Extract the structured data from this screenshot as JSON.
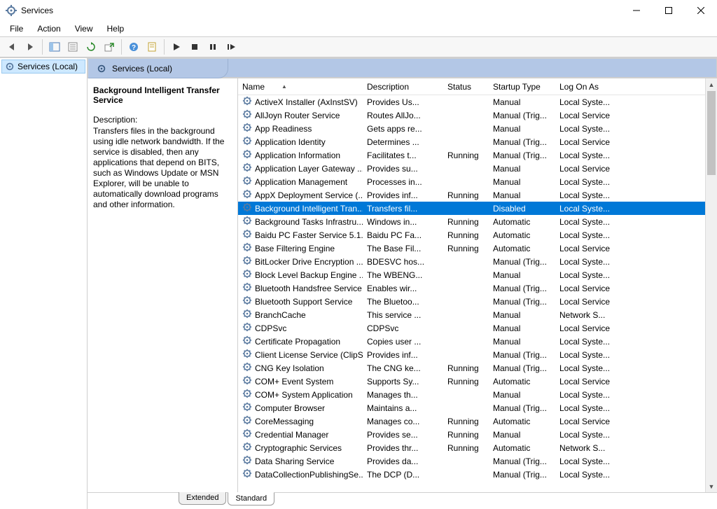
{
  "window": {
    "title": "Services"
  },
  "menu": {
    "file": "File",
    "action": "Action",
    "view": "View",
    "help": "Help"
  },
  "tree": {
    "root": "Services (Local)"
  },
  "header": {
    "label": "Services (Local)"
  },
  "detail": {
    "title": "Background Intelligent Transfer Service",
    "desc_label": "Description:",
    "desc": "Transfers files in the background using idle network bandwidth. If the service is disabled, then any applications that depend on BITS, such as Windows Update or MSN Explorer, will be unable to automatically download programs and other information."
  },
  "columns": {
    "name": "Name",
    "desc": "Description",
    "status": "Status",
    "startup": "Startup Type",
    "logon": "Log On As"
  },
  "tabs": {
    "extended": "Extended",
    "standard": "Standard"
  },
  "services": [
    {
      "name": "ActiveX Installer (AxInstSV)",
      "desc": "Provides Us...",
      "status": "",
      "startup": "Manual",
      "logon": "Local Syste..."
    },
    {
      "name": "AllJoyn Router Service",
      "desc": "Routes AllJo...",
      "status": "",
      "startup": "Manual (Trig...",
      "logon": "Local Service"
    },
    {
      "name": "App Readiness",
      "desc": "Gets apps re...",
      "status": "",
      "startup": "Manual",
      "logon": "Local Syste..."
    },
    {
      "name": "Application Identity",
      "desc": "Determines ...",
      "status": "",
      "startup": "Manual (Trig...",
      "logon": "Local Service"
    },
    {
      "name": "Application Information",
      "desc": "Facilitates t...",
      "status": "Running",
      "startup": "Manual (Trig...",
      "logon": "Local Syste..."
    },
    {
      "name": "Application Layer Gateway ...",
      "desc": "Provides su...",
      "status": "",
      "startup": "Manual",
      "logon": "Local Service"
    },
    {
      "name": "Application Management",
      "desc": "Processes in...",
      "status": "",
      "startup": "Manual",
      "logon": "Local Syste..."
    },
    {
      "name": "AppX Deployment Service (...",
      "desc": "Provides inf...",
      "status": "Running",
      "startup": "Manual",
      "logon": "Local Syste..."
    },
    {
      "name": "Background Intelligent Tran...",
      "desc": "Transfers fil...",
      "status": "",
      "startup": "Disabled",
      "logon": "Local Syste...",
      "selected": true
    },
    {
      "name": "Background Tasks Infrastru...",
      "desc": "Windows in...",
      "status": "Running",
      "startup": "Automatic",
      "logon": "Local Syste..."
    },
    {
      "name": "Baidu PC Faster Service 5.1....",
      "desc": "Baidu PC Fa...",
      "status": "Running",
      "startup": "Automatic",
      "logon": "Local Syste..."
    },
    {
      "name": "Base Filtering Engine",
      "desc": "The Base Fil...",
      "status": "Running",
      "startup": "Automatic",
      "logon": "Local Service"
    },
    {
      "name": "BitLocker Drive Encryption ...",
      "desc": "BDESVC hos...",
      "status": "",
      "startup": "Manual (Trig...",
      "logon": "Local Syste..."
    },
    {
      "name": "Block Level Backup Engine ...",
      "desc": "The WBENG...",
      "status": "",
      "startup": "Manual",
      "logon": "Local Syste..."
    },
    {
      "name": "Bluetooth Handsfree Service",
      "desc": "Enables wir...",
      "status": "",
      "startup": "Manual (Trig...",
      "logon": "Local Service"
    },
    {
      "name": "Bluetooth Support Service",
      "desc": "The Bluetoo...",
      "status": "",
      "startup": "Manual (Trig...",
      "logon": "Local Service"
    },
    {
      "name": "BranchCache",
      "desc": "This service ...",
      "status": "",
      "startup": "Manual",
      "logon": "Network S..."
    },
    {
      "name": "CDPSvc",
      "desc": "CDPSvc",
      "status": "",
      "startup": "Manual",
      "logon": "Local Service"
    },
    {
      "name": "Certificate Propagation",
      "desc": "Copies user ...",
      "status": "",
      "startup": "Manual",
      "logon": "Local Syste..."
    },
    {
      "name": "Client License Service (ClipS...",
      "desc": "Provides inf...",
      "status": "",
      "startup": "Manual (Trig...",
      "logon": "Local Syste..."
    },
    {
      "name": "CNG Key Isolation",
      "desc": "The CNG ke...",
      "status": "Running",
      "startup": "Manual (Trig...",
      "logon": "Local Syste..."
    },
    {
      "name": "COM+ Event System",
      "desc": "Supports Sy...",
      "status": "Running",
      "startup": "Automatic",
      "logon": "Local Service"
    },
    {
      "name": "COM+ System Application",
      "desc": "Manages th...",
      "status": "",
      "startup": "Manual",
      "logon": "Local Syste..."
    },
    {
      "name": "Computer Browser",
      "desc": "Maintains a...",
      "status": "",
      "startup": "Manual (Trig...",
      "logon": "Local Syste..."
    },
    {
      "name": "CoreMessaging",
      "desc": "Manages co...",
      "status": "Running",
      "startup": "Automatic",
      "logon": "Local Service"
    },
    {
      "name": "Credential Manager",
      "desc": "Provides se...",
      "status": "Running",
      "startup": "Manual",
      "logon": "Local Syste..."
    },
    {
      "name": "Cryptographic Services",
      "desc": "Provides thr...",
      "status": "Running",
      "startup": "Automatic",
      "logon": "Network S..."
    },
    {
      "name": "Data Sharing Service",
      "desc": "Provides da...",
      "status": "",
      "startup": "Manual (Trig...",
      "logon": "Local Syste..."
    },
    {
      "name": "DataCollectionPublishingSe...",
      "desc": "The DCP (D...",
      "status": "",
      "startup": "Manual (Trig...",
      "logon": "Local Syste..."
    }
  ]
}
